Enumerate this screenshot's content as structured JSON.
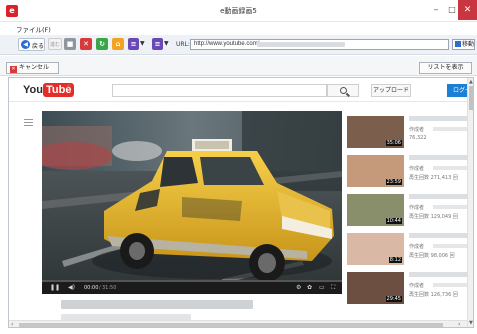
{
  "window": {
    "title": "e動画録画5",
    "app_icon": "e",
    "minimize": "–",
    "maximize": "□",
    "close": "✕"
  },
  "menu": {
    "file": "ファイル(F)"
  },
  "toolbar": {
    "back_arrow": "◀",
    "back_label": "戻る",
    "forward_label": "進む",
    "url_label": "URL:",
    "url_value": "http://www.youtube.com/",
    "go_label": "移動",
    "dropdown_arrow": "▼"
  },
  "actions": {
    "cancel_label": "キャンセル",
    "cancel_icon": "✕",
    "list_label": "リストを表示"
  },
  "youtube": {
    "logo_you": "You",
    "logo_tube": "Tube",
    "logo_region": "JP",
    "upload_label": "アップロード",
    "login_label": "ログイ"
  },
  "player": {
    "current_time": "00:00",
    "separator": "/",
    "duration": "31:50",
    "progress_fraction": 0,
    "play_icon": "❚❚",
    "volume_icon": "◀)",
    "settings_icon": "⚙",
    "gear_icon": "✿",
    "screen_icon": "▭",
    "fullscreen_icon": "⛶"
  },
  "sidebar": {
    "items": [
      {
        "duration": "35:06",
        "channel": "作成者",
        "views": "76,322",
        "thumb_color": "#7b5e4c"
      },
      {
        "duration": "23:59",
        "channel": "作成者",
        "views": "再生回数 271,413 回",
        "thumb_color": "#c59a7a"
      },
      {
        "duration": "10:44",
        "channel": "作成者",
        "views": "再生回数 129,049 回",
        "thumb_color": "#8a8f6b"
      },
      {
        "duration": "8:12",
        "channel": "作成者",
        "views": "再生回数 98,006 回",
        "thumb_color": "#d9b9a5"
      },
      {
        "duration": "29:45",
        "channel": "作成者",
        "views": "再生回数 126,736 回",
        "thumb_color": "#6d4f42"
      }
    ]
  },
  "scrollbars": {
    "up": "▲",
    "down": "▼",
    "left": "‹",
    "right": "›"
  }
}
